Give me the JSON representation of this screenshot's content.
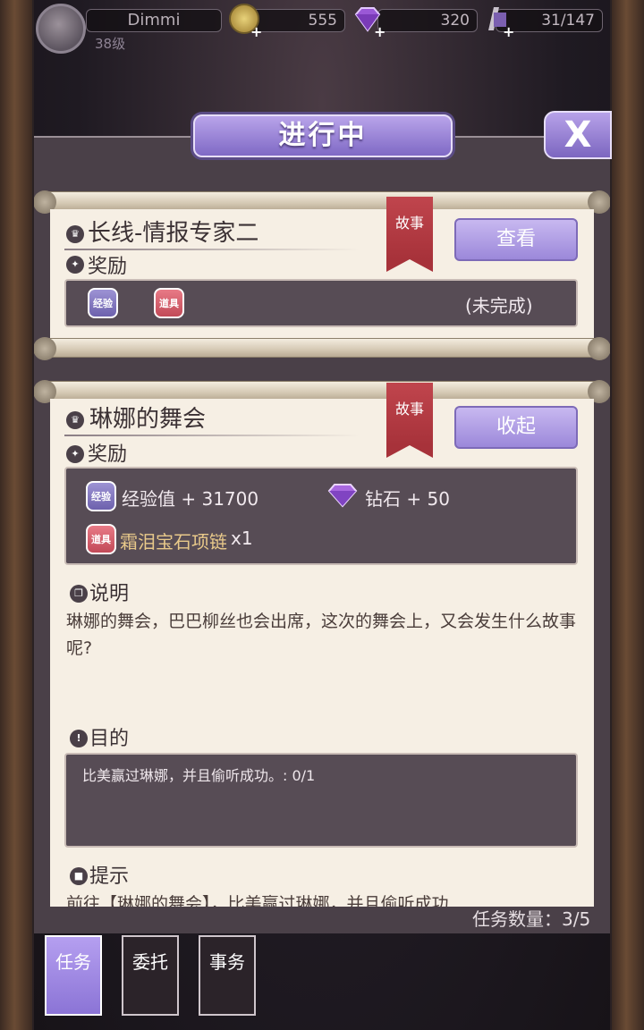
{
  "status": {
    "player_name": "Dimmi",
    "level": "38级",
    "gold": "555",
    "diamond": "320",
    "stamina": "31/147",
    "plus": "+"
  },
  "title": "进行中",
  "close_label": "X",
  "quests": [
    {
      "title": "长线-情报专家二",
      "ribbon": "故事",
      "button": "查看",
      "reward_label": "奖励",
      "badges": [
        "经验",
        "道具"
      ],
      "status": "(未完成)"
    },
    {
      "title": "琳娜的舞会",
      "ribbon": "故事",
      "button": "收起",
      "reward_label": "奖励",
      "rewards": {
        "exp_badge": "经验",
        "exp_text": "经验值 + 31700",
        "diamond_text": "钻石 + 50",
        "item_badge": "道具",
        "item_name": "霜泪宝石项链",
        "item_count": "x1"
      },
      "desc_label": "说明",
      "desc_text": "琳娜的舞会，巴巴柳丝也会出席，这次的舞会上，又会发生什么故事呢?",
      "goal_label": "目的",
      "goal_text": "比美赢过琳娜，并且偷听成功。: 0/1",
      "hint_label": "提示",
      "hint_text": "前往【琳娜的舞会】，比美赢过琳娜，并且偷听成功"
    }
  ],
  "task_count": "任务数量：3/5",
  "tabs": [
    "任务",
    "委托",
    "事务"
  ],
  "colors": {
    "accent": "#9c88da",
    "ribbon": "#b33a42",
    "paper": "#f6efe4"
  }
}
